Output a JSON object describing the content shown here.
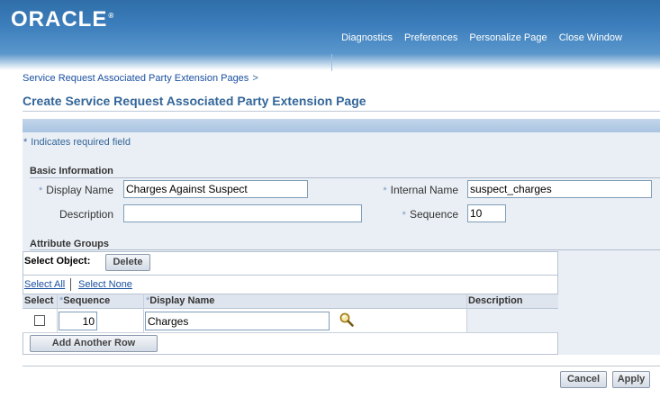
{
  "header": {
    "logo": "ORACLE",
    "logo_reg": "®",
    "global_links": [
      "Diagnostics",
      "Preferences",
      "Personalize Page",
      "Close Window"
    ]
  },
  "breadcrumb": {
    "item": "Service Request Associated Party Extension Pages",
    "separator": ">"
  },
  "page_title": "Create Service Request Associated Party Extension Page",
  "required_hint": {
    "star": "*",
    "text": "Indicates required field"
  },
  "basic_info": {
    "header": "Basic Information",
    "display_name": {
      "label": "Display Name",
      "value": "Charges Against Suspect"
    },
    "internal_name": {
      "label": "Internal Name",
      "value": "suspect_charges"
    },
    "description": {
      "label": "Description",
      "value": ""
    },
    "sequence": {
      "label": "Sequence",
      "value": "10"
    }
  },
  "attribute_groups": {
    "header": "Attribute Groups",
    "select_object_label": "Select Object:",
    "delete_button": "Delete",
    "select_all": "Select All",
    "select_none": "Select None",
    "columns": [
      "Select",
      "Sequence",
      "Display Name",
      "Description"
    ],
    "rows": [
      {
        "selected": false,
        "sequence": "10",
        "display_name": "Charges",
        "description": ""
      }
    ],
    "add_row_button": "Add Another Row"
  },
  "actions": {
    "cancel": "Cancel",
    "apply": "Apply"
  }
}
